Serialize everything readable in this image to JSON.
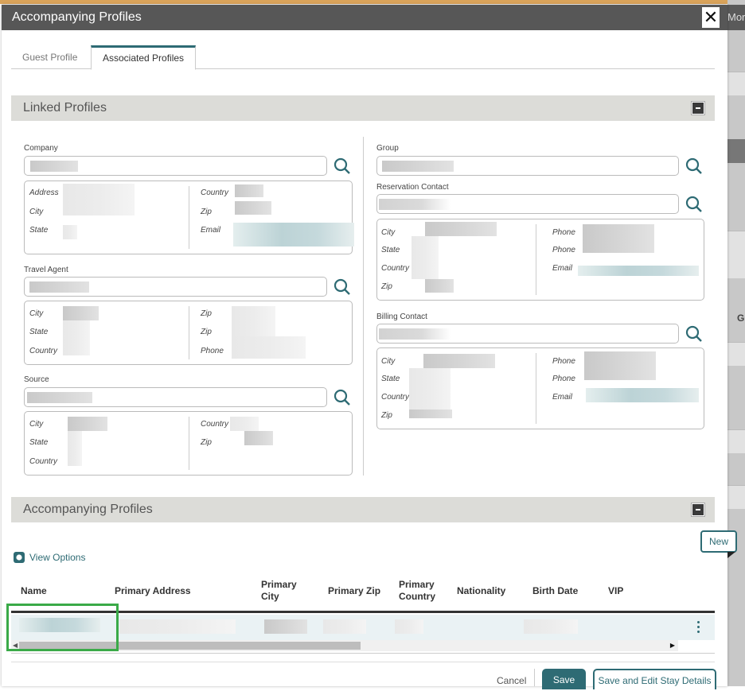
{
  "dialog": {
    "title": "Accompanying Profiles",
    "close_icon": "close-icon",
    "background_partial_text_top": "Mor",
    "background_partial_text_mid": "Gr"
  },
  "tabs": [
    {
      "label": "Guest Profile",
      "active": false
    },
    {
      "label": "Associated Profiles",
      "active": true
    }
  ],
  "linked_profiles": {
    "title": "Linked Profiles",
    "collapse_icon": "collapse-icon",
    "left": {
      "company": {
        "label": "Company",
        "value": "",
        "details_left": [
          "Address",
          "City",
          "State"
        ],
        "details_right": [
          "Country",
          "Zip",
          "Email"
        ]
      },
      "travel_agent": {
        "label": "Travel Agent",
        "value": "",
        "details_left": [
          "City",
          "State",
          "Country"
        ],
        "details_right": [
          "Zip",
          "Zip",
          "Phone"
        ]
      },
      "source": {
        "label": "Source",
        "value": "",
        "details_left": [
          "City",
          "State",
          "Country"
        ],
        "details_right": [
          "Country",
          "Zip"
        ]
      }
    },
    "right": {
      "group": {
        "label": "Group",
        "value": ""
      },
      "reservation_contact": {
        "label": "Reservation Contact",
        "value": "",
        "details_left": [
          "City",
          "State",
          "Country",
          "Zip"
        ],
        "details_right": [
          "Phone",
          "Phone",
          "Email"
        ]
      },
      "billing_contact": {
        "label": "Billing Contact",
        "value": "",
        "details_left": [
          "City",
          "State",
          "Country",
          "Zip"
        ],
        "details_right": [
          "Phone",
          "Phone",
          "Email"
        ]
      }
    }
  },
  "accompanying_profiles": {
    "title": "Accompanying Profiles",
    "collapse_icon": "collapse-icon",
    "view_options_label": "View Options",
    "new_label": "New",
    "columns": [
      "Name",
      "Primary Address",
      "Primary City",
      "Primary Zip",
      "Primary Country",
      "Nationality",
      "Birth Date",
      "VIP"
    ],
    "rows": [
      {
        "name": "",
        "primary_address": "",
        "primary_city": "",
        "primary_zip": "",
        "primary_country": "",
        "nationality": "",
        "birth_date": "",
        "vip": ""
      }
    ]
  },
  "footer": {
    "cancel_label": "Cancel",
    "save_label": "Save",
    "save_edit_label": "Save and Edit Stay Details"
  },
  "colors": {
    "accent": "#2e6b74",
    "titlebar": "#575757",
    "section_header": "#dcdcd8",
    "highlight": "#3aaa48",
    "row_selected": "#eaf2f4"
  }
}
